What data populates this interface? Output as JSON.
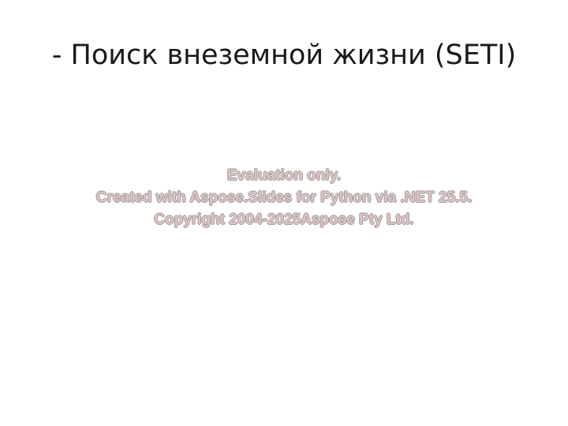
{
  "slide": {
    "title": "- Поиск внеземной жизни (SETI)"
  },
  "watermark": {
    "line1": "Evaluation only.",
    "line2": "Created with Aspose.Slides for Python via .NET 25.5.",
    "line3": "Copyright 2004-2025Aspose Pty Ltd."
  }
}
